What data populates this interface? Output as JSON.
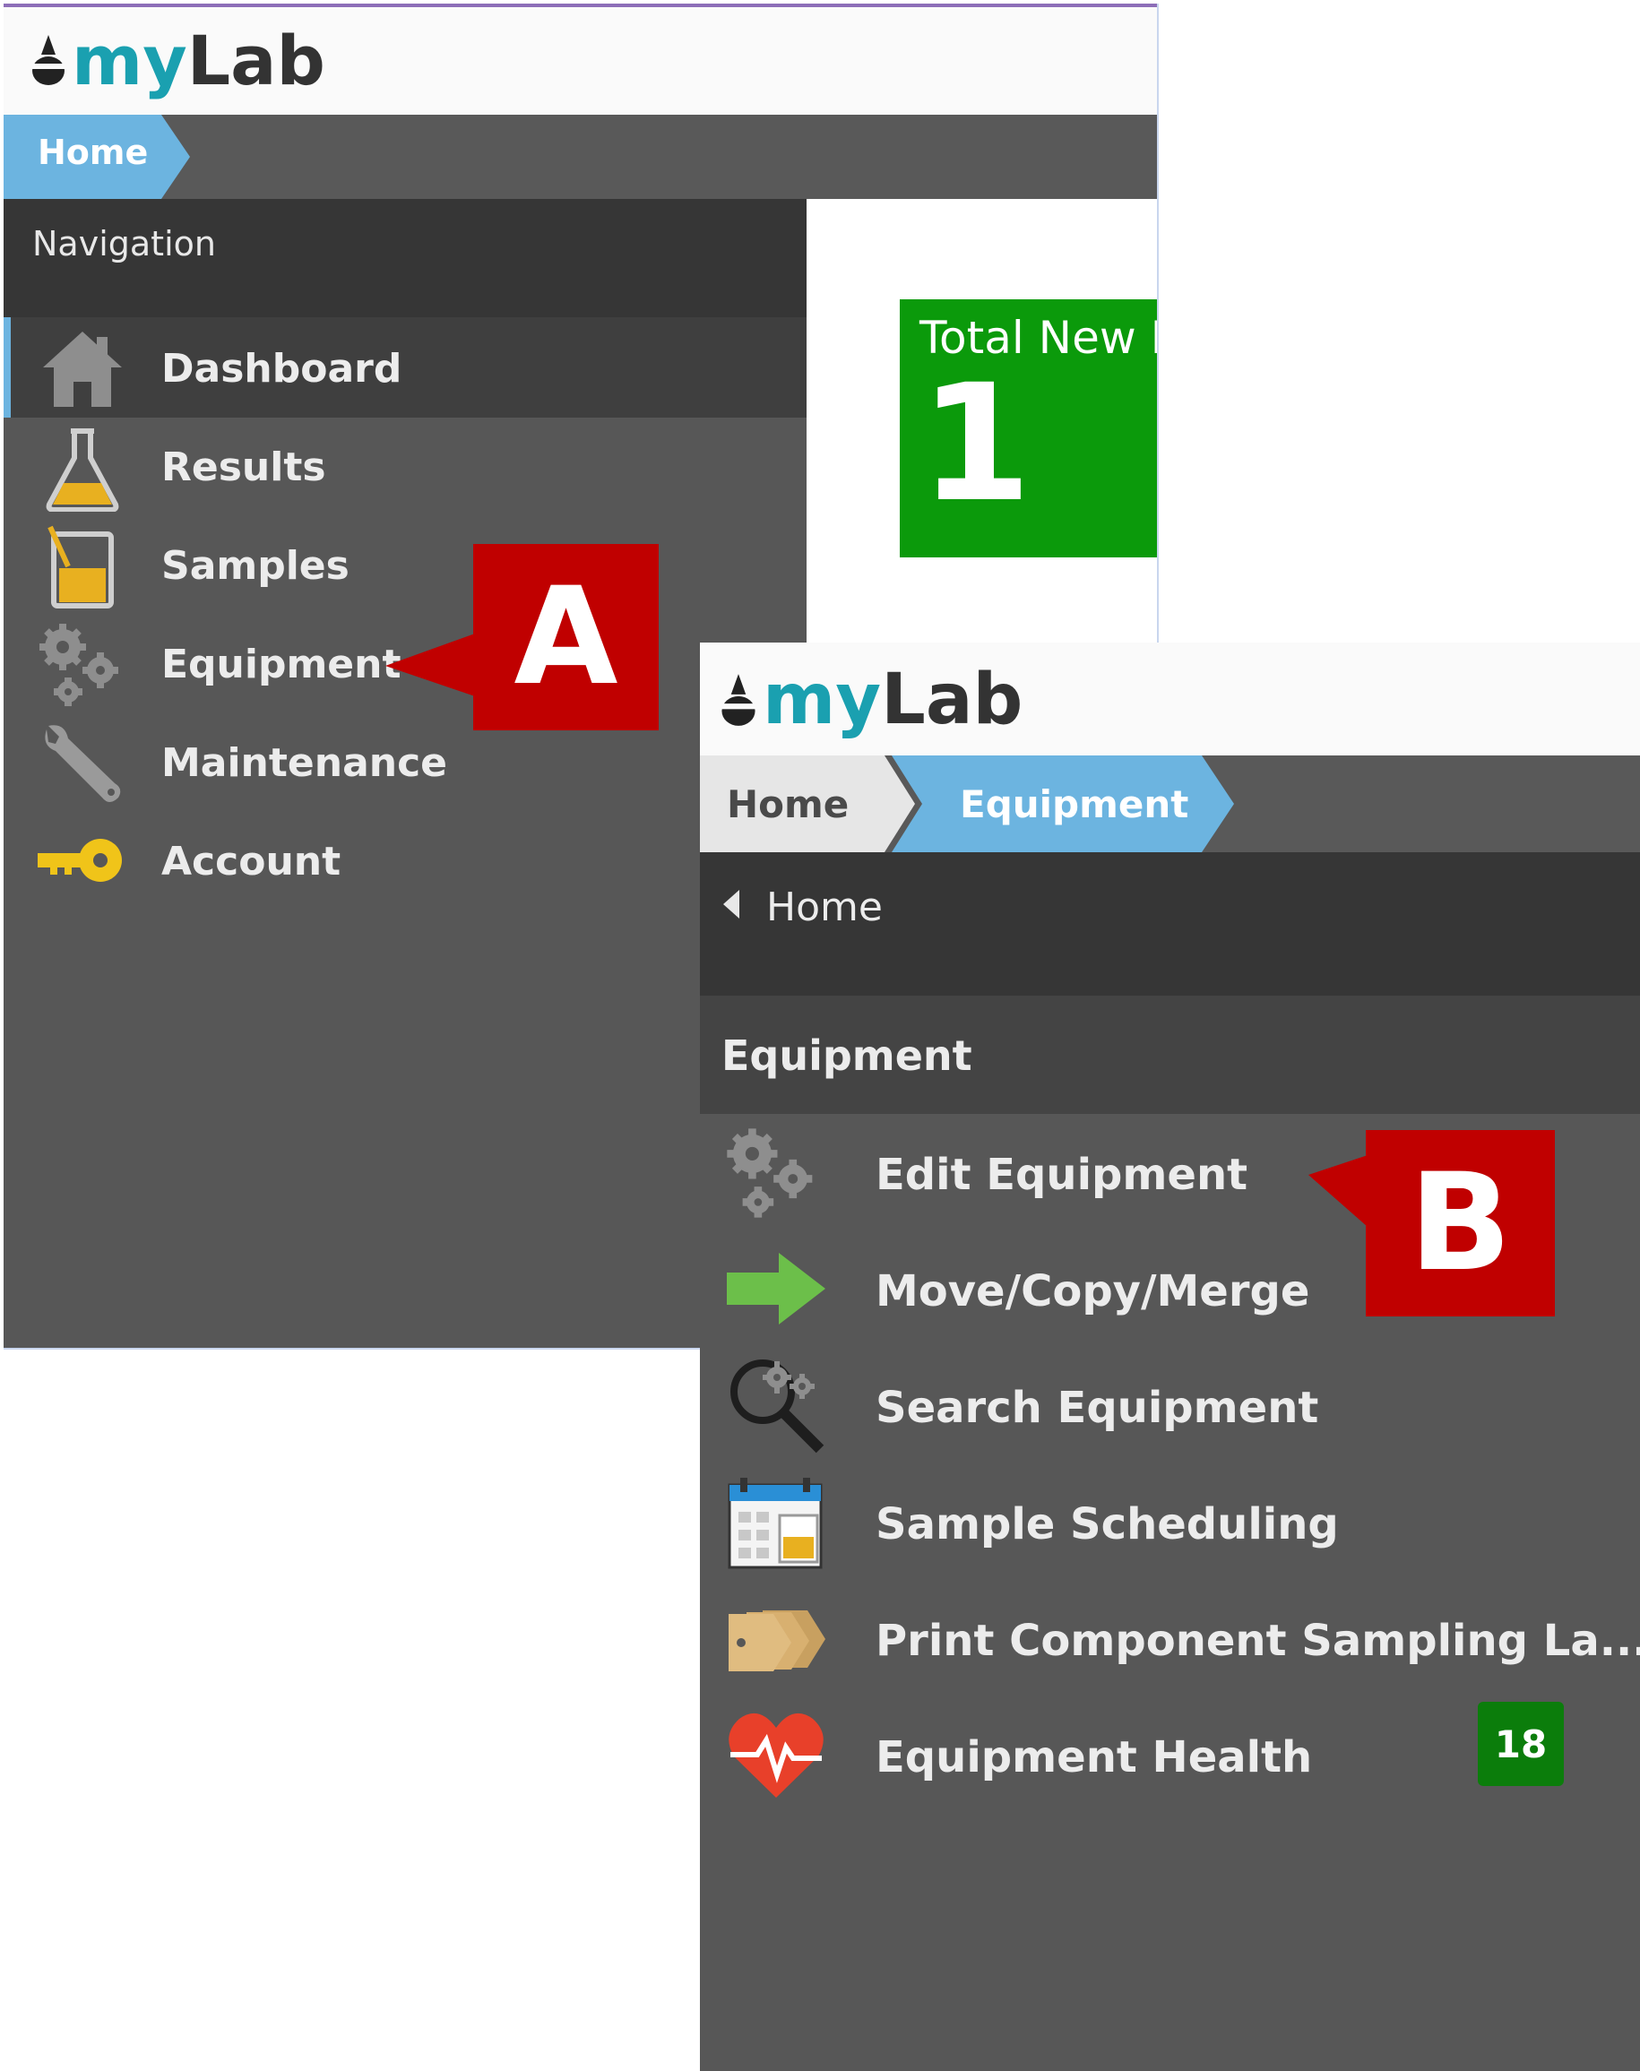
{
  "panel_a": {
    "logo": {
      "prefix": "my",
      "suffix": "Lab"
    },
    "breadcrumb": [
      "Home"
    ],
    "nav_header": "Navigation",
    "nav_items": [
      {
        "label": "Dashboard",
        "icon": "home-icon",
        "active": true
      },
      {
        "label": "Results",
        "icon": "flask-icon"
      },
      {
        "label": "Samples",
        "icon": "sample-jar-icon"
      },
      {
        "label": "Equipment",
        "icon": "gears-icon"
      },
      {
        "label": "Maintenance",
        "icon": "wrench-icon"
      },
      {
        "label": "Account",
        "icon": "key-icon"
      }
    ],
    "tile": {
      "title": "Total New R",
      "value": "1"
    },
    "callout": "A"
  },
  "panel_b": {
    "logo": {
      "prefix": "my",
      "suffix": "Lab"
    },
    "breadcrumb": [
      "Home",
      "Equipment"
    ],
    "back_label": "Home",
    "section_title": "Equipment",
    "items": [
      {
        "label": "Edit Equipment",
        "icon": "gears-icon"
      },
      {
        "label": "Move/Copy/Merge",
        "icon": "green-arrow-icon"
      },
      {
        "label": "Search Equipment",
        "icon": "search-gear-icon"
      },
      {
        "label": "Sample Scheduling",
        "icon": "calendar-icon"
      },
      {
        "label": "Print Component Sampling La...",
        "icon": "labels-icon"
      },
      {
        "label": "Equipment Health",
        "icon": "heart-pulse-icon",
        "badge": "18"
      }
    ],
    "callout": "B"
  },
  "colors": {
    "accent_blue": "#6cb4e0",
    "tile_green": "#0b9a0b",
    "callout_red": "#c00000",
    "sidebar_gray": "#575757"
  }
}
